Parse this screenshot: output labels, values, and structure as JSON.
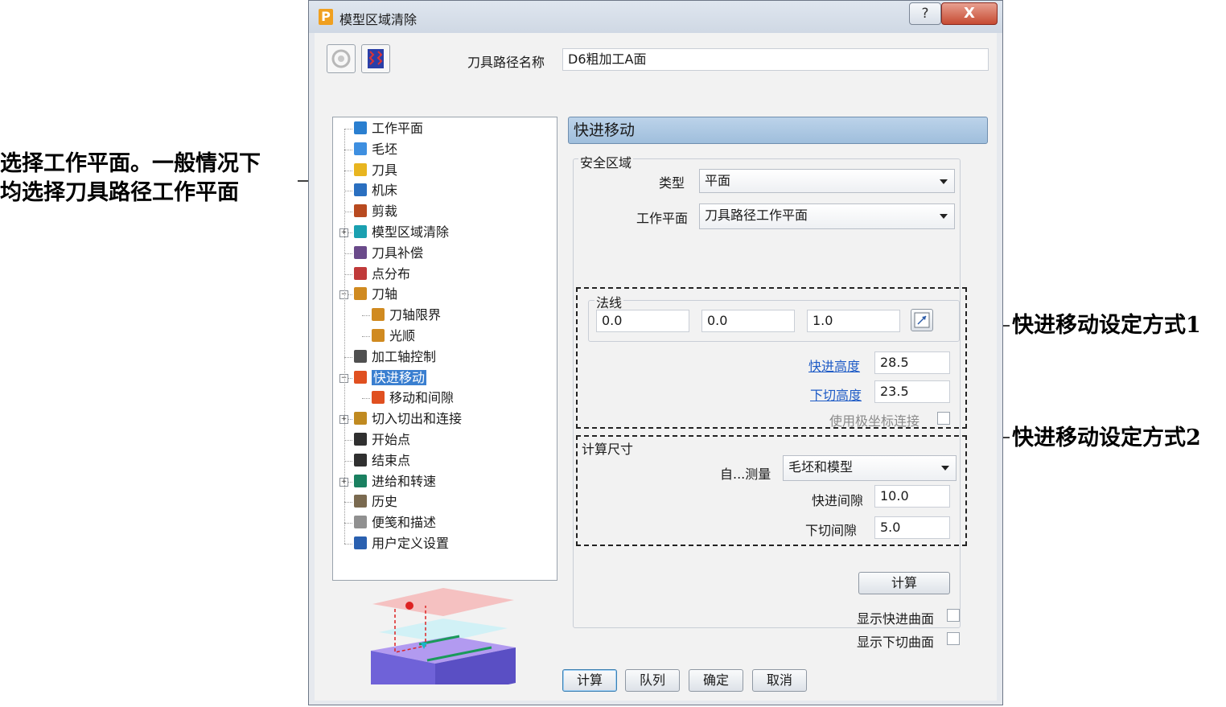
{
  "annotations": {
    "left_line1": "选择工作平面。一般情况下",
    "left_line2": "均选择刀具路径工作平面",
    "right_1": "快进移动设定方式1",
    "right_2": "快进移动设定方式2"
  },
  "window": {
    "title": "模型区域清除",
    "logo": "P",
    "help": "?",
    "close": "X"
  },
  "toolpath_name": {
    "label": "刀具路径名称",
    "value": "D6粗加工A面"
  },
  "tree": [
    {
      "label": "工作平面",
      "icon": "workplane-icon"
    },
    {
      "label": "毛坯",
      "icon": "block-icon"
    },
    {
      "label": "刀具",
      "icon": "tool-icon"
    },
    {
      "label": "机床",
      "icon": "machine-icon"
    },
    {
      "label": "剪裁",
      "icon": "limit-icon"
    },
    {
      "label": "模型区域清除",
      "icon": "area-clear-icon"
    },
    {
      "label": "刀具补偿",
      "icon": "compensation-icon"
    },
    {
      "label": "点分布",
      "icon": "point-distribution-icon"
    },
    {
      "label": "刀轴",
      "icon": "tool-axis-icon"
    },
    {
      "label": "刀轴限界",
      "icon": "tool-axis-limit-icon"
    },
    {
      "label": "光顺",
      "icon": "smoothing-icon"
    },
    {
      "label": "加工轴控制",
      "icon": "axis-control-icon"
    },
    {
      "label": "快进移动",
      "icon": "rapid-move-icon"
    },
    {
      "label": "移动和间隙",
      "icon": "moves-gaps-icon"
    },
    {
      "label": "切入切出和连接",
      "icon": "leads-links-icon"
    },
    {
      "label": "开始点",
      "icon": "start-point-icon"
    },
    {
      "label": "结束点",
      "icon": "end-point-icon"
    },
    {
      "label": "进给和转速",
      "icon": "feeds-speeds-icon"
    },
    {
      "label": "历史",
      "icon": "history-icon"
    },
    {
      "label": "便笺和描述",
      "icon": "notes-icon"
    },
    {
      "label": "用户定义设置",
      "icon": "user-settings-icon"
    }
  ],
  "panel": {
    "title": "快进移动",
    "safe_area": {
      "title": "安全区域",
      "type_label": "类型",
      "type_value": "平面",
      "workplane_label": "工作平面",
      "workplane_value": "刀具路径工作平面",
      "normal_title": "法线",
      "normal": [
        "0.0",
        "0.0",
        "1.0"
      ],
      "rapid_height_label": "快进高度",
      "rapid_height": "28.5",
      "plunge_height_label": "下切高度",
      "plunge_height": "23.5",
      "polar_label": "使用极坐标连接"
    },
    "calc": {
      "title": "计算尺寸",
      "measure_label": "自...测量",
      "measure_value": "毛坯和模型",
      "rapid_gap_label": "快进间隙",
      "rapid_gap": "10.0",
      "plunge_gap_label": "下切间隙",
      "plunge_gap": "5.0",
      "calc_button": "计算"
    },
    "show_rapid_surface": "显示快进曲面",
    "show_plunge_surface": "显示下切曲面"
  },
  "buttons": {
    "calculate": "计算",
    "queue": "队列",
    "ok": "确定",
    "cancel": "取消"
  },
  "colors": {
    "header": "#a9c6e3",
    "link": "#1e5bc6",
    "selection": "#3a7fd0"
  }
}
